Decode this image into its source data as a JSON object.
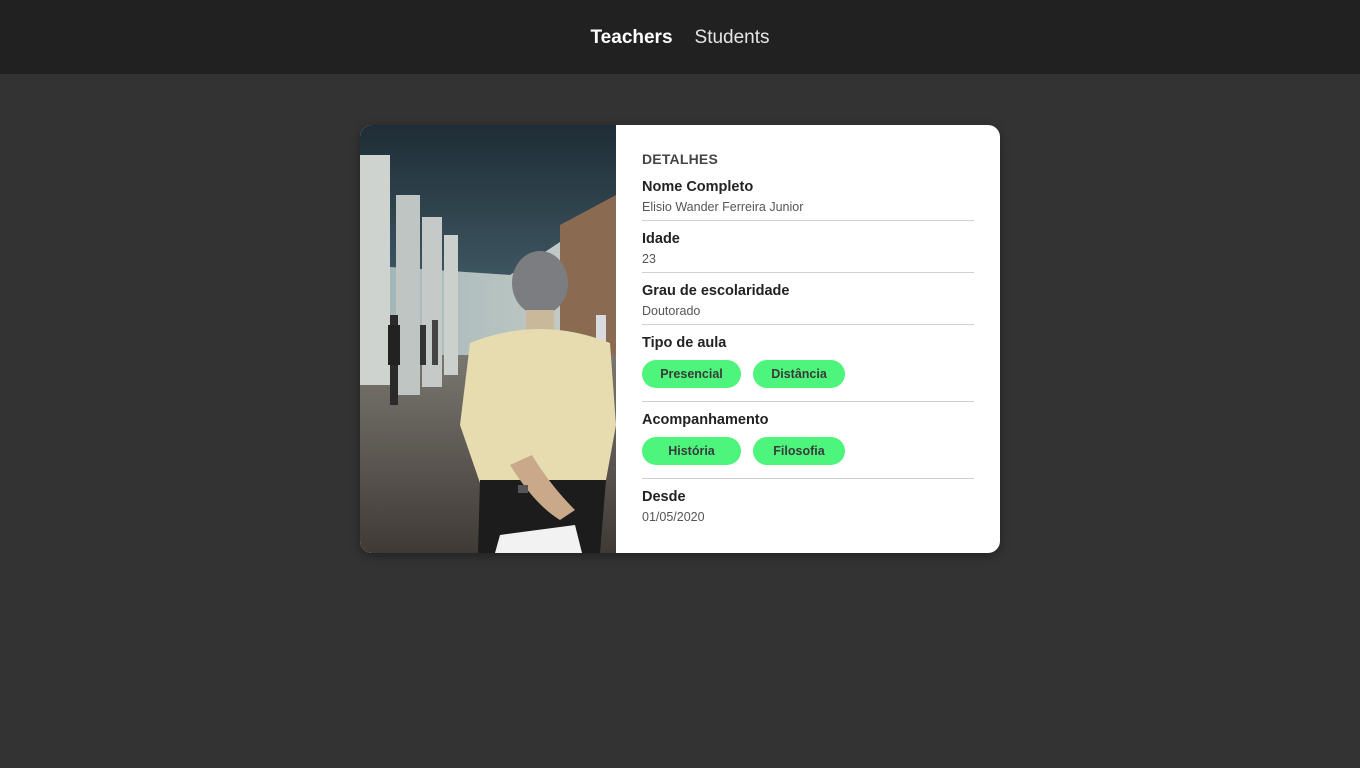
{
  "nav": {
    "items": [
      {
        "label": "Teachers",
        "active": true
      },
      {
        "label": "Students",
        "active": false
      }
    ]
  },
  "card": {
    "photo_icon": "teacher-photo",
    "section_title": "DETALHES",
    "fields": {
      "full_name": {
        "label": "Nome Completo",
        "value": "Elisio Wander Ferreira Junior"
      },
      "age": {
        "label": "Idade",
        "value": "23"
      },
      "education": {
        "label": "Grau de escolaridade",
        "value": "Doutorado"
      },
      "class_type": {
        "label": "Tipo de aula",
        "pills": [
          "Presencial",
          "Distância"
        ]
      },
      "subjects": {
        "label": "Acompanhamento",
        "pills": [
          "História",
          "Filosofia"
        ]
      },
      "since": {
        "label": "Desde",
        "value": "01/05/2020"
      }
    }
  },
  "colors": {
    "background": "#333333",
    "header": "#212121",
    "card": "#ffffff",
    "pill": "#4ef57c"
  }
}
